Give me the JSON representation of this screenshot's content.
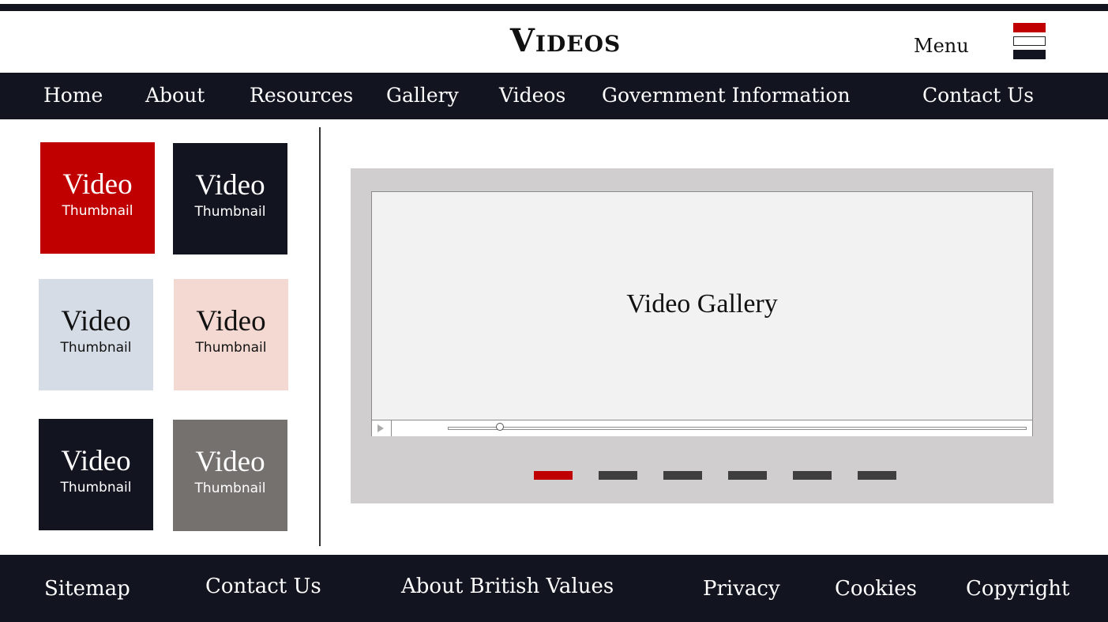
{
  "header": {
    "title": "Videos",
    "menu_label": "Menu",
    "menu_icon": "hamburger-menu-icon"
  },
  "nav": {
    "items": [
      {
        "label": "Home"
      },
      {
        "label": "About"
      },
      {
        "label": "Resources"
      },
      {
        "label": "Gallery"
      },
      {
        "label": "Videos"
      },
      {
        "label": "Government Information"
      },
      {
        "label": "Contact Us"
      }
    ]
  },
  "thumbnails": [
    {
      "line1": "Video",
      "line2": "Thumbnail",
      "bg": "#c00000",
      "fg": "#ffffff"
    },
    {
      "line1": "Video",
      "line2": "Thumbnail",
      "bg": "#121420",
      "fg": "#ffffff"
    },
    {
      "line1": "Video",
      "line2": "Thumbnail",
      "bg": "#d5dce6",
      "fg": "#111111"
    },
    {
      "line1": "Video",
      "line2": "Thumbnail",
      "bg": "#f4d9d2",
      "fg": "#111111"
    },
    {
      "line1": "Video",
      "line2": "Thumbnail",
      "bg": "#121420",
      "fg": "#ffffff"
    },
    {
      "line1": "Video",
      "line2": "Thumbnail",
      "bg": "#75716f",
      "fg": "#ffffff"
    }
  ],
  "player": {
    "title": "Video Gallery",
    "play_icon": "play-icon",
    "progress": 0.09
  },
  "pager": {
    "count": 6,
    "active_index": 0
  },
  "footer": {
    "items": [
      {
        "label": "Sitemap"
      },
      {
        "label": "Contact Us"
      },
      {
        "label": "About British Values"
      },
      {
        "label": "Privacy"
      },
      {
        "label": "Cookies"
      },
      {
        "label": "Copyright"
      }
    ]
  },
  "colors": {
    "accent": "#c00000",
    "dark": "#121420",
    "frame": "#d0cecf",
    "pager_inactive": "#3f3f3f"
  }
}
